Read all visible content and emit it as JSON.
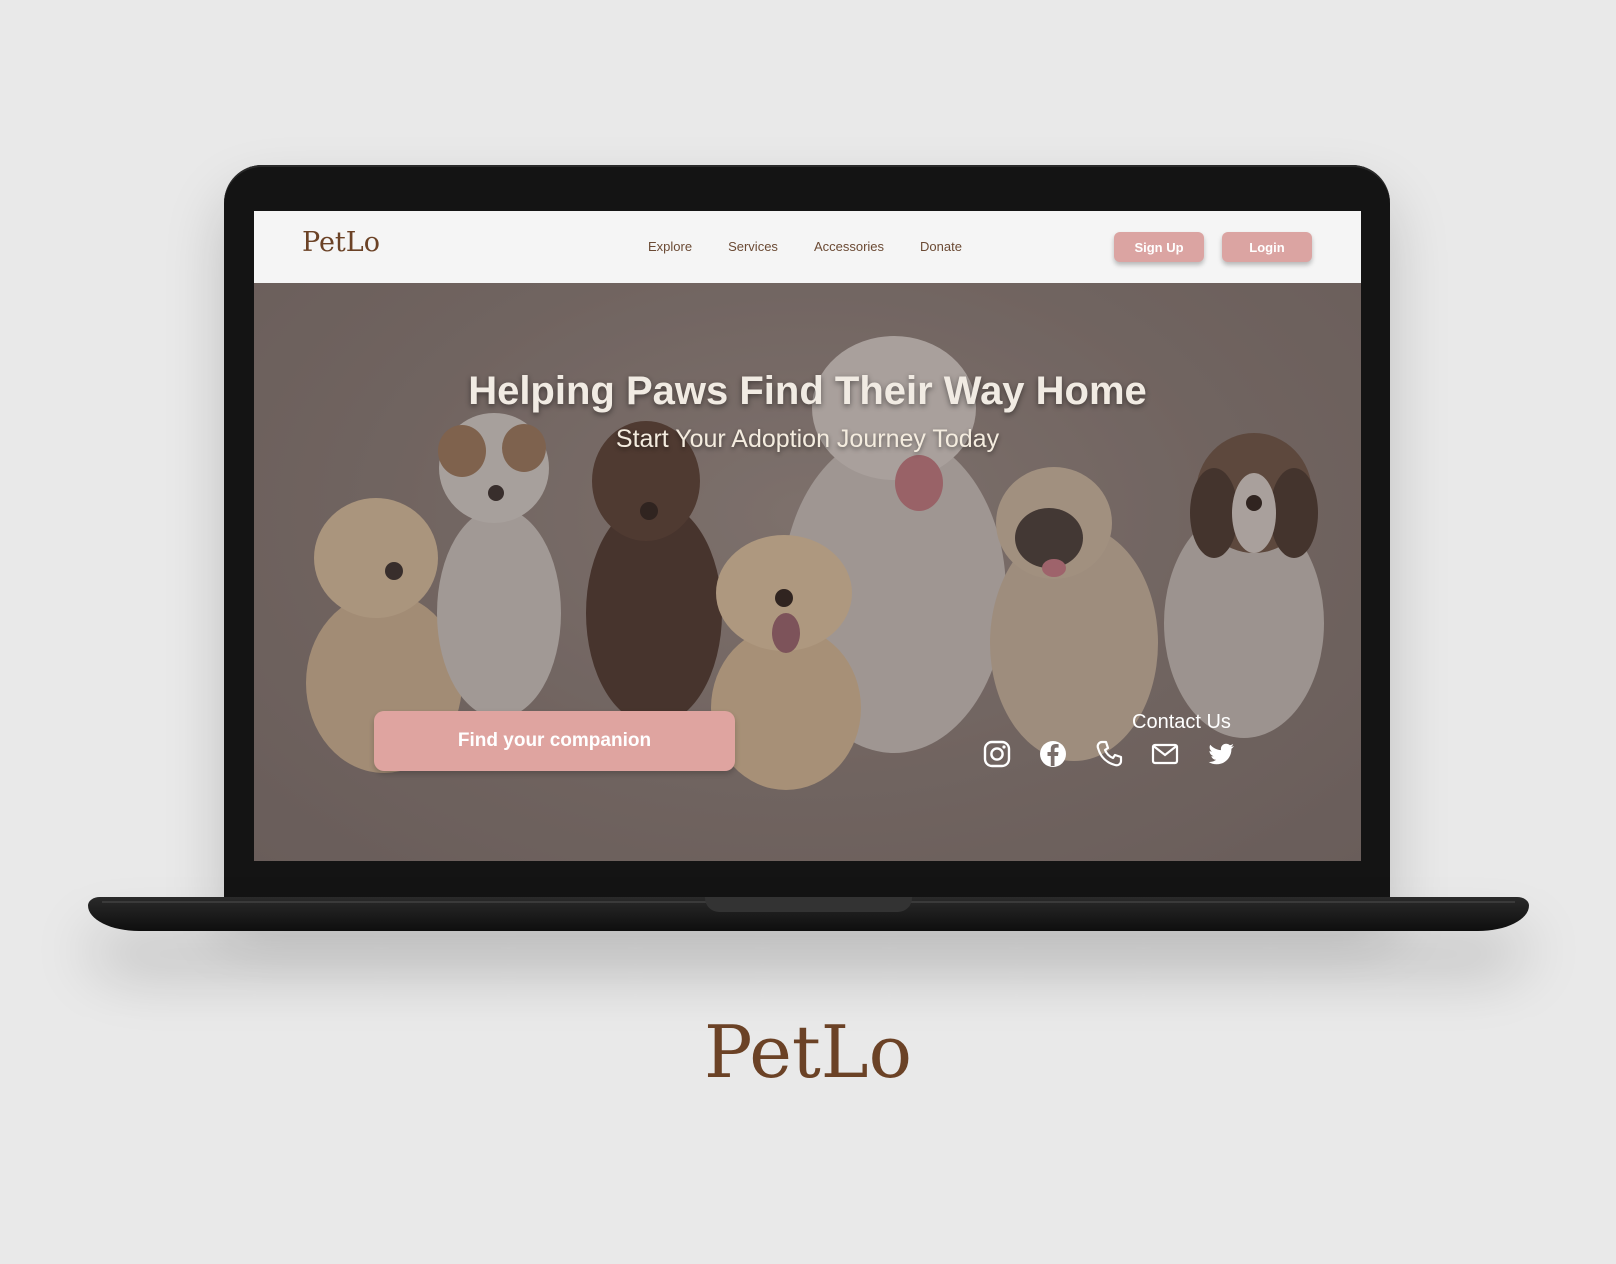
{
  "navbar": {
    "logo": "PetLo",
    "menu": [
      "Explore",
      "Services",
      "Accessories",
      "Donate"
    ],
    "signup_label": "Sign Up",
    "login_label": "Login"
  },
  "hero": {
    "headline": "Helping Paws Find Their Way Home",
    "subheadline": "Start Your Adoption Journey Today",
    "cta_label": "Find your companion",
    "contact_label": "Contact Us",
    "social_icons": [
      "instagram-icon",
      "facebook-icon",
      "phone-icon",
      "mail-icon",
      "twitter-icon"
    ]
  },
  "brand_caption": "PetLo",
  "colors": {
    "accent": "#dba4a2",
    "brand_brown": "#6b4226",
    "navbar_bg": "#f5f5f5",
    "page_bg": "#e9e9e9"
  }
}
